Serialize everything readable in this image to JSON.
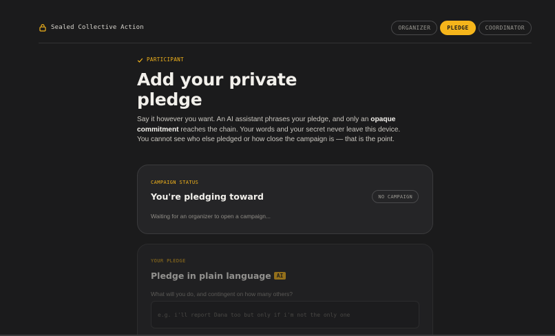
{
  "header": {
    "app_name": "Sealed Collective Action",
    "roles": [
      {
        "label": "ORGANIZER",
        "active": false
      },
      {
        "label": "PLEDGE",
        "active": true
      },
      {
        "label": "COORDINATOR",
        "active": false
      }
    ]
  },
  "intro": {
    "eyebrow": "PARTICIPANT",
    "title": "Add your private pledge",
    "lede_part1": "Say it however you want. An AI assistant phrases your pledge, and only an ",
    "lede_strong": "opaque commitment",
    "lede_part2": " reaches the chain. Your words and your secret never leave this device. You cannot see who else pledged or how close the campaign is — that is the point."
  },
  "status_card": {
    "label": "CAMPAIGN STATUS",
    "heading": "You're pledging toward",
    "badge": "NO CAMPAIGN",
    "message": "Waiting for an organizer to open a campaign..."
  },
  "pledge_card": {
    "label": "YOUR PLEDGE",
    "heading": "Pledge in plain language",
    "ai_tag": "AI",
    "question": "What will you do, and contingent on how many others?",
    "placeholder": "e.g. i'll report Dana too but only if i'm not the only one",
    "value": ""
  },
  "colors": {
    "accent": "#f5b51b",
    "background": "#1b1b1c",
    "card": "#252527"
  },
  "icons": {
    "brand": "lock-icon",
    "eyebrow": "check-icon"
  }
}
